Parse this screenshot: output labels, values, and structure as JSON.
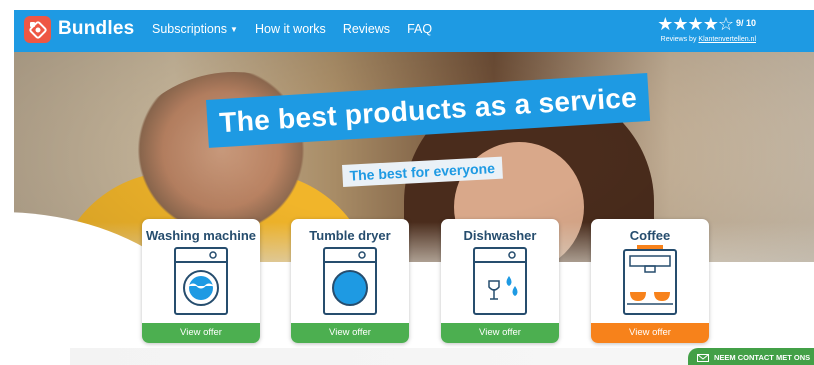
{
  "brand": {
    "name": "Bundles",
    "logo_icon": "bundles-logo-icon"
  },
  "nav": {
    "items": [
      {
        "label": "Subscriptions",
        "has_dropdown": true
      },
      {
        "label": "How it works"
      },
      {
        "label": "Reviews"
      },
      {
        "label": "FAQ"
      }
    ]
  },
  "rating": {
    "stars_visual": "★★★★☆",
    "stars_value": 4.5,
    "score": "9",
    "score_max": "/ 10",
    "reviews_prefix": "Reviews by",
    "reviews_source": "Klantenvertellen.nl"
  },
  "hero": {
    "headline": "The best products as a service",
    "subline": "The best for everyone"
  },
  "products": [
    {
      "title": "Washing machine",
      "button": "View offer",
      "icon": "washing-machine-icon",
      "button_color": "#4caf50"
    },
    {
      "title": "Tumble dryer",
      "button": "View offer",
      "icon": "tumble-dryer-icon",
      "button_color": "#4caf50"
    },
    {
      "title": "Dishwasher",
      "button": "View offer",
      "icon": "dishwasher-icon",
      "button_color": "#4caf50"
    },
    {
      "title": "Coffee",
      "button": "View offer",
      "icon": "coffee-machine-icon",
      "button_color": "#f7821b"
    }
  ],
  "contact": {
    "label": "NEEM CONTACT MET ONS",
    "icon": "mail-icon"
  },
  "colors": {
    "primary": "#1e9ae3",
    "accent_red": "#ee5744",
    "green": "#4caf50",
    "orange": "#f7821b",
    "navy_text": "#264d6e"
  }
}
